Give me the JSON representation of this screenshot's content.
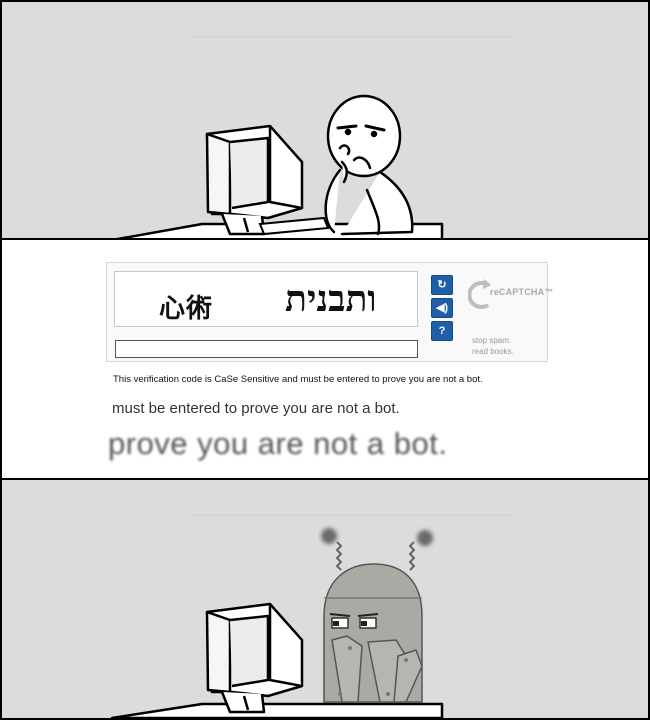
{
  "captcha": {
    "word_left": "心術",
    "word_right": "ותבנית",
    "input_value": "",
    "buttons": [
      {
        "name": "refresh-icon",
        "glyph": "↻"
      },
      {
        "name": "audio-icon",
        "glyph": "◀)"
      },
      {
        "name": "help-icon",
        "glyph": "?"
      }
    ],
    "logo_text": "reCAPTCHA™",
    "tagline_1": "stop spam.",
    "tagline_2": "read books."
  },
  "caption": {
    "small": "This verification code is CaSe Sensitive and must be entered to prove you are not a bot.",
    "medium": "must be entered to prove you are not a bot.",
    "large": "prove you are not a bot."
  },
  "colors": {
    "panel_bg": "#dcdcdc",
    "robot_gray": "#a8aba4",
    "button_blue": "#1f5fa8"
  }
}
